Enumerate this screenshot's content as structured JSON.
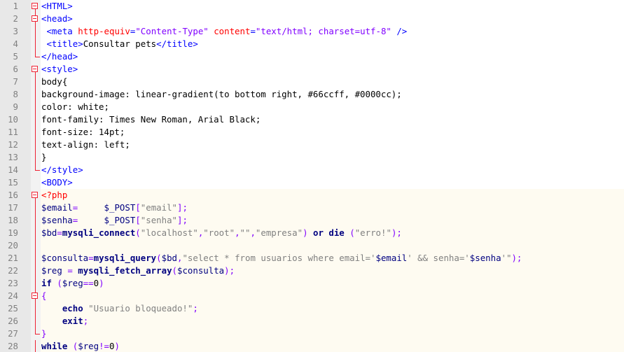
{
  "editor": {
    "lines": [
      {
        "n": "1",
        "fold": "box",
        "tokens": [
          [
            "tag",
            "<HTML>"
          ]
        ]
      },
      {
        "n": "2",
        "fold": "box",
        "tokens": [
          [
            "tag",
            "<head>"
          ]
        ]
      },
      {
        "n": "3",
        "fold": "rail",
        "tokens": [
          [
            "plain",
            " "
          ],
          [
            "tag",
            "<meta "
          ],
          [
            "attr",
            "http-equiv"
          ],
          [
            "tag",
            "="
          ],
          [
            "val",
            "\"Content-Type\""
          ],
          [
            "plain",
            " "
          ],
          [
            "attr",
            "content"
          ],
          [
            "tag",
            "="
          ],
          [
            "val",
            "\"text/html; charset=utf-8\""
          ],
          [
            "tag",
            " />"
          ]
        ]
      },
      {
        "n": "4",
        "fold": "rail",
        "tokens": [
          [
            "plain",
            " "
          ],
          [
            "tag",
            "<title>"
          ],
          [
            "plain",
            "Consultar pets"
          ],
          [
            "tag",
            "</title>"
          ]
        ]
      },
      {
        "n": "5",
        "fold": "end",
        "tokens": [
          [
            "tag",
            "</head>"
          ]
        ]
      },
      {
        "n": "6",
        "fold": "box",
        "tokens": [
          [
            "tag",
            "<style>"
          ]
        ]
      },
      {
        "n": "7",
        "fold": "rail",
        "tokens": [
          [
            "plain",
            "body{"
          ]
        ]
      },
      {
        "n": "8",
        "fold": "rail",
        "tokens": [
          [
            "plain",
            "background-image: linear-gradient(to bottom right, #66ccff, #0000cc);"
          ]
        ]
      },
      {
        "n": "9",
        "fold": "rail",
        "tokens": [
          [
            "plain",
            "color: white;"
          ]
        ]
      },
      {
        "n": "10",
        "fold": "rail",
        "tokens": [
          [
            "plain",
            "font-family: Times New Roman, Arial Black;"
          ]
        ]
      },
      {
        "n": "11",
        "fold": "rail",
        "tokens": [
          [
            "plain",
            "font-size: 14pt;"
          ]
        ]
      },
      {
        "n": "12",
        "fold": "rail",
        "tokens": [
          [
            "plain",
            "text-align: left;"
          ]
        ]
      },
      {
        "n": "13",
        "fold": "rail",
        "tokens": [
          [
            "plain",
            "}"
          ]
        ]
      },
      {
        "n": "14",
        "fold": "end",
        "tokens": [
          [
            "tag",
            "</style>"
          ]
        ]
      },
      {
        "n": "15",
        "fold": "none",
        "tokens": [
          [
            "tag",
            "<BODY>"
          ]
        ]
      },
      {
        "n": "16",
        "fold": "box",
        "php": true,
        "tokens": [
          [
            "phptag",
            "<?php"
          ]
        ]
      },
      {
        "n": "17",
        "fold": "rail",
        "php": true,
        "tokens": [
          [
            "var",
            "$email"
          ],
          [
            "op",
            "="
          ],
          [
            "plain",
            "     "
          ],
          [
            "var",
            "$_POST"
          ],
          [
            "op",
            "["
          ],
          [
            "str",
            "\"email\""
          ],
          [
            "op",
            "];"
          ]
        ]
      },
      {
        "n": "18",
        "fold": "rail",
        "php": true,
        "tokens": [
          [
            "var",
            "$senha"
          ],
          [
            "op",
            "="
          ],
          [
            "plain",
            "     "
          ],
          [
            "var",
            "$_POST"
          ],
          [
            "op",
            "["
          ],
          [
            "str",
            "\"senha\""
          ],
          [
            "op",
            "];"
          ]
        ]
      },
      {
        "n": "19",
        "fold": "rail",
        "php": true,
        "tokens": [
          [
            "var",
            "$bd"
          ],
          [
            "op",
            "="
          ],
          [
            "fn",
            "mysqli_connect"
          ],
          [
            "op",
            "("
          ],
          [
            "str",
            "\"localhost\""
          ],
          [
            "op",
            ","
          ],
          [
            "str",
            "\"root\""
          ],
          [
            "op",
            ","
          ],
          [
            "str",
            "\"\""
          ],
          [
            "op",
            ","
          ],
          [
            "str",
            "\"empresa\""
          ],
          [
            "op",
            ")"
          ],
          [
            "plain",
            " "
          ],
          [
            "kw",
            "or"
          ],
          [
            "plain",
            " "
          ],
          [
            "kw",
            "die"
          ],
          [
            "plain",
            " "
          ],
          [
            "op",
            "("
          ],
          [
            "str",
            "\"erro!\""
          ],
          [
            "op",
            ");"
          ]
        ]
      },
      {
        "n": "20",
        "fold": "rail",
        "php": true,
        "tokens": []
      },
      {
        "n": "21",
        "fold": "rail",
        "php": true,
        "tokens": [
          [
            "var",
            "$consulta"
          ],
          [
            "op",
            "="
          ],
          [
            "fn",
            "mysqli_query"
          ],
          [
            "op",
            "("
          ],
          [
            "var",
            "$bd"
          ],
          [
            "op",
            ","
          ],
          [
            "str",
            "\"select * from usuarios where email='"
          ],
          [
            "var",
            "$email"
          ],
          [
            "str",
            "' && senha='"
          ],
          [
            "var",
            "$senha"
          ],
          [
            "str",
            "'\""
          ],
          [
            "op",
            ");"
          ]
        ]
      },
      {
        "n": "22",
        "fold": "rail",
        "php": true,
        "tokens": [
          [
            "var",
            "$reg"
          ],
          [
            "plain",
            " "
          ],
          [
            "op",
            "="
          ],
          [
            "plain",
            " "
          ],
          [
            "fn",
            "mysqli_fetch_array"
          ],
          [
            "op",
            "("
          ],
          [
            "var",
            "$consulta"
          ],
          [
            "op",
            ");"
          ]
        ]
      },
      {
        "n": "23",
        "fold": "rail",
        "php": true,
        "tokens": [
          [
            "kw",
            "if"
          ],
          [
            "plain",
            " "
          ],
          [
            "op",
            "("
          ],
          [
            "var",
            "$reg"
          ],
          [
            "op",
            "=="
          ],
          [
            "plain",
            "0"
          ],
          [
            "op",
            ")"
          ]
        ]
      },
      {
        "n": "24",
        "fold": "box",
        "php": true,
        "tokens": [
          [
            "op",
            "{"
          ]
        ]
      },
      {
        "n": "25",
        "fold": "rail",
        "php": true,
        "tokens": [
          [
            "plain",
            "    "
          ],
          [
            "kw",
            "echo"
          ],
          [
            "plain",
            " "
          ],
          [
            "str",
            "\"Usuario bloqueado!\""
          ],
          [
            "op",
            ";"
          ]
        ]
      },
      {
        "n": "26",
        "fold": "rail",
        "php": true,
        "tokens": [
          [
            "plain",
            "    "
          ],
          [
            "kw",
            "exit"
          ],
          [
            "op",
            ";"
          ]
        ]
      },
      {
        "n": "27",
        "fold": "end",
        "php": true,
        "tokens": [
          [
            "op",
            "}"
          ]
        ]
      },
      {
        "n": "28",
        "fold": "rail",
        "php": true,
        "tokens": [
          [
            "kw",
            "while"
          ],
          [
            "plain",
            " "
          ],
          [
            "op",
            "("
          ],
          [
            "var",
            "$reg"
          ],
          [
            "op",
            "!="
          ],
          [
            "plain",
            "0"
          ],
          [
            "op",
            ")"
          ]
        ]
      }
    ]
  }
}
